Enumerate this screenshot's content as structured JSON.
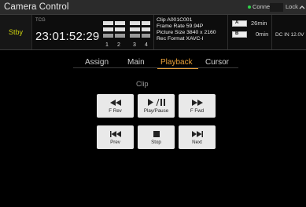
{
  "title_bar": {
    "app_title": "Camera Control",
    "connection_status": "Connected",
    "connection_color": "#2fd24a",
    "lock_label": "Lock"
  },
  "status": {
    "mode": "Stby",
    "mode_color": "#cfd40e",
    "tc_label": "TCG",
    "timecode": "23:01:52:29",
    "audio_channels": [
      "1",
      "2",
      "3",
      "4"
    ],
    "clip": {
      "clip_label": "Clip",
      "clip_name": "A001C001",
      "frame_rate_label": "Frame Rate",
      "frame_rate": "59.94P",
      "picture_size_label": "Picture Size",
      "picture_size": "3840 x 2160",
      "rec_format_label": "Rec Format",
      "rec_format": "XAVC-I"
    },
    "media": [
      {
        "slot": "A",
        "remaining": "26min"
      },
      {
        "slot": "B",
        "remaining": "0min"
      }
    ],
    "power": "DC IN 12.0V"
  },
  "tabs": [
    {
      "label": "Assign",
      "active": false
    },
    {
      "label": "Main",
      "active": false
    },
    {
      "label": "Playback",
      "active": true
    },
    {
      "label": "Cursor",
      "active": false
    }
  ],
  "playback": {
    "section_title": "Clip",
    "buttons": [
      {
        "id": "frev",
        "label": "F Rev",
        "icon": "rewind-icon"
      },
      {
        "id": "playpause",
        "label": "Play/Pause",
        "icon": "play-pause-icon"
      },
      {
        "id": "ffwd",
        "label": "F Fwd",
        "icon": "fast-forward-icon"
      },
      {
        "id": "prev",
        "label": "Prev",
        "icon": "skip-previous-icon"
      },
      {
        "id": "stop",
        "label": "Stop",
        "icon": "stop-icon"
      },
      {
        "id": "next",
        "label": "Next",
        "icon": "skip-next-icon"
      }
    ]
  },
  "colors": {
    "accent": "#e8a03a",
    "background": "#000000",
    "button_face": "#e9e9e9"
  }
}
